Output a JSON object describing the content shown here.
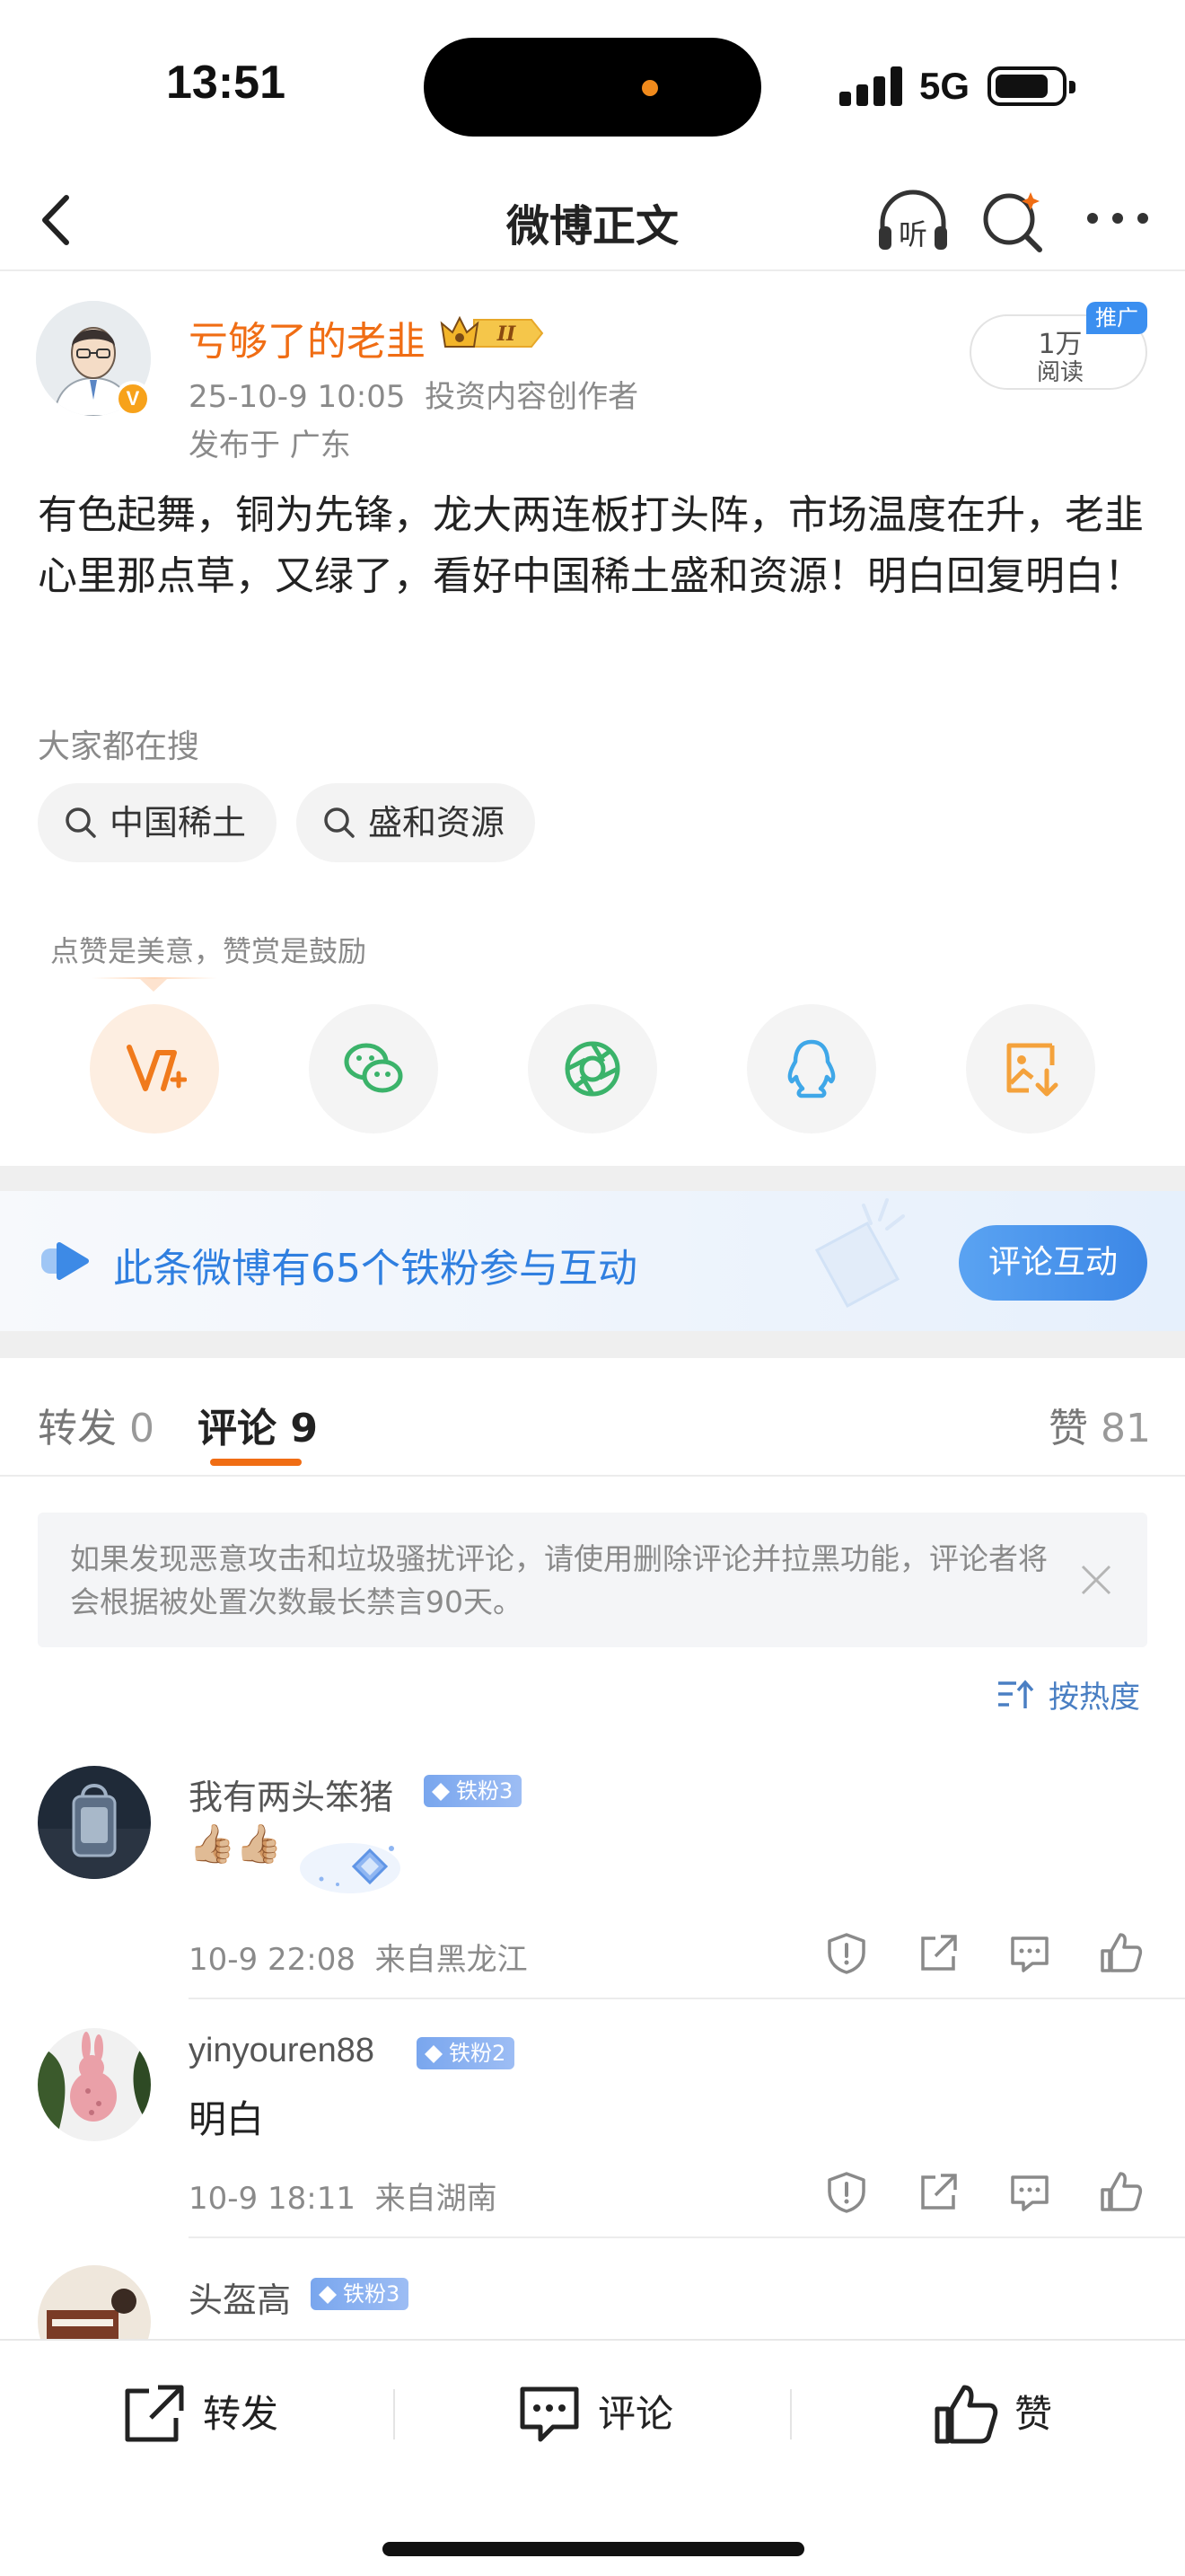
{
  "status_bar": {
    "time": "13:51",
    "network": "5G"
  },
  "nav": {
    "title": "微博正文"
  },
  "post": {
    "author_name": "亏够了的老韭",
    "date_time": "25-10-9 10:05",
    "author_title": "投资内容创作者",
    "location": "发布于 广东",
    "reads_count": "1万",
    "reads_label": "阅读",
    "promo_label": "推广",
    "text": "有色起舞，铜为先锋，龙大两连板打头阵，市场温度在升，老韭心里那点草，又绿了，看好中国稀土盛和资源！明白回复明白！"
  },
  "hot_search": {
    "label": "大家都在搜",
    "chips": [
      "中国稀土",
      "盛和资源"
    ]
  },
  "share": {
    "tip": "点赞是美意，赞赏是鼓励",
    "icons": [
      "weibo-reward-icon",
      "wechat-icon",
      "moments-icon",
      "qq-icon",
      "save-image-icon"
    ]
  },
  "fans_banner": {
    "text": "此条微博有65个铁粉参与互动",
    "button": "评论互动"
  },
  "tabs": {
    "repost_label": "转发",
    "repost_count": "0",
    "comment_label": "评论",
    "comment_count": "9",
    "like_label": "赞",
    "like_count": "81"
  },
  "notice": {
    "text": "如果发现恶意攻击和垃圾骚扰评论，请使用删除评论并拉黑功能，评论者将会根据被处置次数最长禁言90天。"
  },
  "sort": {
    "label": "按热度"
  },
  "comments": [
    {
      "name": "我有两头笨猪",
      "badge": "铁粉3",
      "body": "👍🏼👍🏼",
      "time": "10-9 22:08",
      "from": "来自黑龙江"
    },
    {
      "name": "yinyouren88",
      "badge": "铁粉2",
      "body": "明白",
      "time": "10-9 18:11",
      "from": "来自湖南"
    },
    {
      "name": "头盔高",
      "badge": "铁粉3"
    }
  ],
  "bottom_bar": {
    "repost": "转发",
    "comment": "评论",
    "like": "赞"
  },
  "colors": {
    "accent_orange": "#f06d14",
    "link_blue": "#2f7fe0",
    "badge_blue": "#79a6ee"
  }
}
